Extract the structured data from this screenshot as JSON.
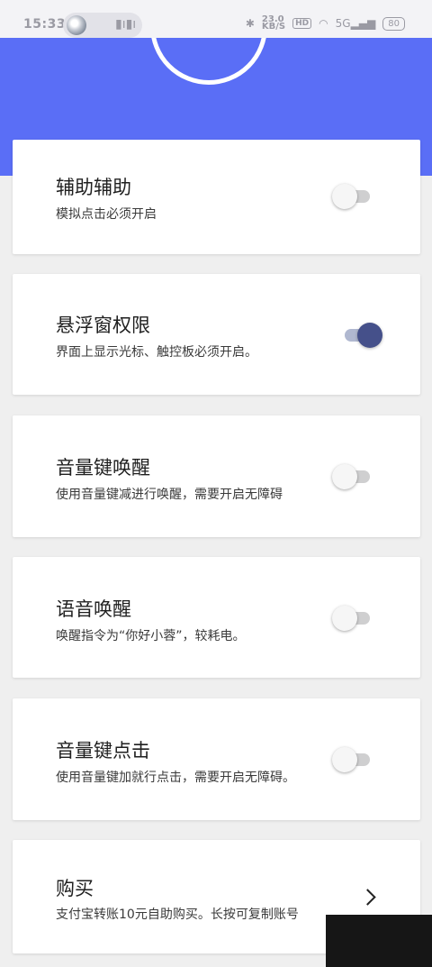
{
  "status_bar": {
    "time": "15:33",
    "network_speed": "23.0",
    "network_unit": "KB/S",
    "hd_label": "HD",
    "signal_label": "5G",
    "battery": "80"
  },
  "settings": [
    {
      "title": "辅助辅助",
      "description": "模拟点击必须开启",
      "control": "toggle",
      "enabled": false
    },
    {
      "title": "悬浮窗权限",
      "description": "界面上显示光标、触控板必须开启。",
      "control": "toggle",
      "enabled": true
    },
    {
      "title": "音量键唤醒",
      "description": "使用音量键减进行唤醒，需要开启无障碍",
      "control": "toggle",
      "enabled": false
    },
    {
      "title": "语音唤醒",
      "description": "唤醒指令为“你好小蓉”，较耗电。",
      "control": "toggle",
      "enabled": false
    },
    {
      "title": "音量键点击",
      "description": "使用音量键加就行点击，需要开启无障碍。",
      "control": "toggle",
      "enabled": false
    },
    {
      "title": "购买",
      "description": "支付宝转账10元自助购买。长按可复制账号",
      "control": "chevron"
    }
  ],
  "colors": {
    "header_blue": "#5a6ef6",
    "toggle_on_thumb": "#45508a",
    "toggle_on_track": "#b0b8d0",
    "toggle_off_track": "#cfcfd0",
    "background": "#efefef"
  }
}
